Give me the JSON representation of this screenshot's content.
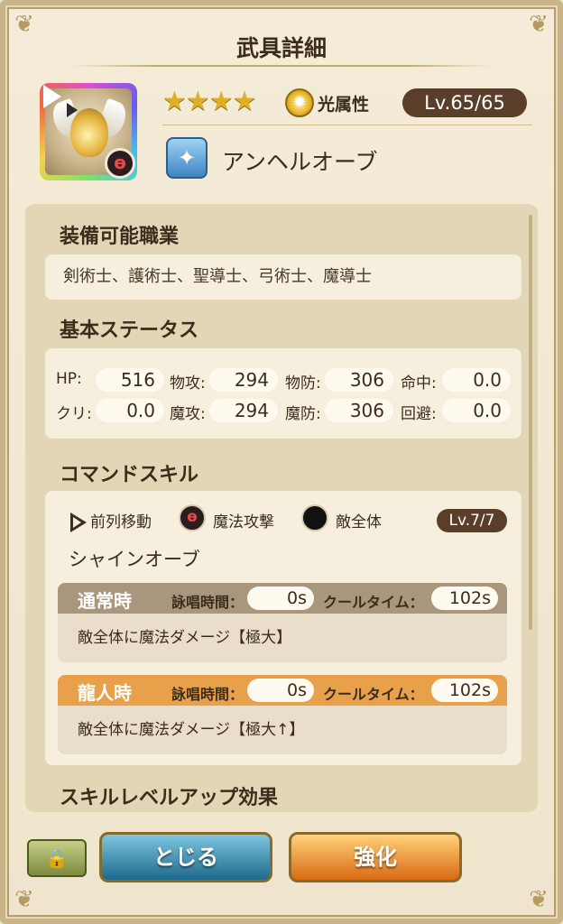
{
  "title": "武具詳細",
  "weapon": {
    "stars": "★★★★",
    "attribute_label": "光属性",
    "level": "Lv.65/65",
    "name": "アンヘルオーブ",
    "type_icon": "sparkle-icon"
  },
  "jobs": {
    "heading": "装備可能職業",
    "list": "剣術士、護術士、聖導士、弓術士、魔導士"
  },
  "stats": {
    "heading": "基本ステータス",
    "items": [
      {
        "label": "HP:",
        "value": "516"
      },
      {
        "label": "物攻:",
        "value": "294"
      },
      {
        "label": "物防:",
        "value": "306"
      },
      {
        "label": "命中:",
        "value": "0.0"
      },
      {
        "label": "クリ:",
        "value": "0.0"
      },
      {
        "label": "魔攻:",
        "value": "294"
      },
      {
        "label": "魔防:",
        "value": "306"
      },
      {
        "label": "回避:",
        "value": "0.0"
      }
    ]
  },
  "command_skill": {
    "heading": "コマンドスキル",
    "tags": [
      "前列移動",
      "魔法攻撃",
      "敵全体"
    ],
    "level": "Lv.7/7",
    "name": "シャインオーブ",
    "modes": [
      {
        "name": "通常時",
        "chant_label": "詠唱時間：",
        "chant": "0s",
        "cool_label": "クールタイム：",
        "cool": "102s",
        "desc": "敵全体に魔法ダメージ【極大】",
        "color": "#a8977c"
      },
      {
        "name": "龍人時",
        "chant_label": "詠唱時間：",
        "chant": "0s",
        "cool_label": "クールタイム：",
        "cool": "102s",
        "desc": "敵全体に魔法ダメージ【極大↑】",
        "color": "#e9a04a"
      }
    ]
  },
  "skill_levelup_heading": "スキルレベルアップ効果",
  "buttons": {
    "close": "とじる",
    "enhance": "強化"
  }
}
